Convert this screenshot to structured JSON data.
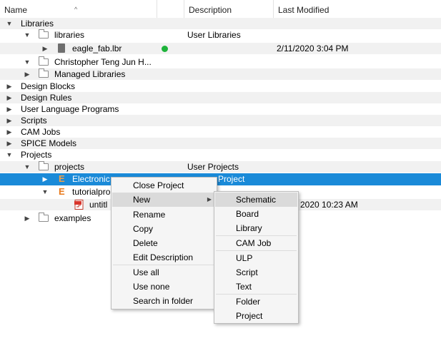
{
  "header": {
    "name": "Name",
    "description": "Description",
    "last_modified": "Last Modified",
    "sort_arrow": "^"
  },
  "tree": {
    "libraries_root": "Libraries",
    "libraries_folder": "libraries",
    "libraries_desc": "User Libraries",
    "eagle_fab": "eagle_fab.lbr",
    "eagle_fab_date": "2/11/2020 3:04 PM",
    "christopher": "Christopher Teng Jun H...",
    "managed": "Managed Libraries",
    "design_blocks": "Design Blocks",
    "design_rules": "Design Rules",
    "ulp": "User Language Programs",
    "scripts": "Scripts",
    "cam_jobs": "CAM Jobs",
    "spice": "SPICE Models",
    "projects_root": "Projects",
    "projects_folder": "projects",
    "projects_desc": "User Projects",
    "electronic": "Electronic",
    "electronic_desc": "Project",
    "tutorial": "tutorialpro",
    "untitled": "untitl",
    "untitled_date": "2020 10:23 AM",
    "examples": "examples"
  },
  "context_menu": {
    "items": [
      "Close Project",
      "New",
      "Rename",
      "Copy",
      "Delete",
      "Edit Description",
      "Use all",
      "Use none",
      "Search in folder"
    ]
  },
  "submenu": {
    "items": [
      "Schematic",
      "Board",
      "Library",
      "CAM Job",
      "ULP",
      "Script",
      "Text",
      "Folder",
      "Project"
    ]
  },
  "colors": {
    "selection": "#1a8ad8",
    "status_dot": "#1db33a",
    "eagle_icon": "#e87a1d"
  }
}
